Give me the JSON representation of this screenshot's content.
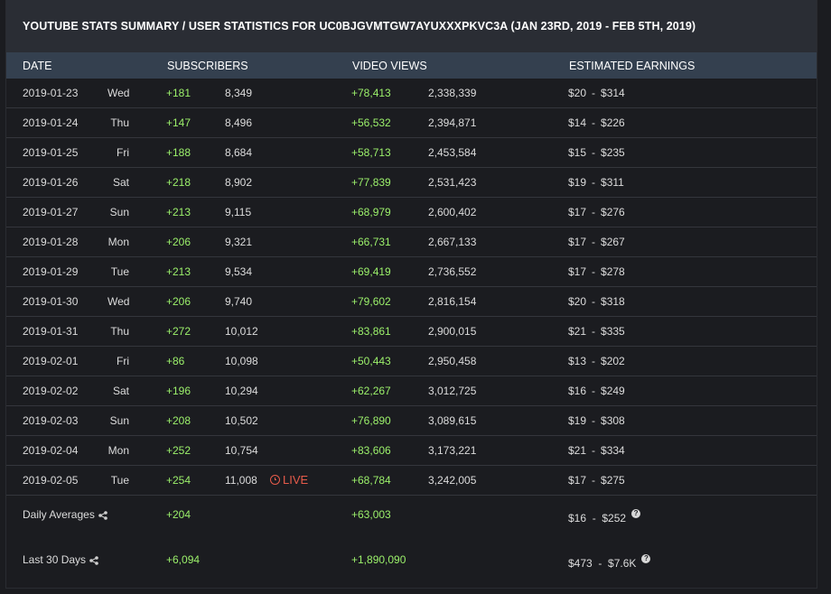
{
  "title": "YOUTUBE STATS SUMMARY / USER STATISTICS FOR UC0BJGVMTGW7AYUXXXPKVC3A (JAN 23RD, 2019 - FEB 5TH, 2019)",
  "headers": {
    "date": "DATE",
    "subscribers": "SUBSCRIBERS",
    "views": "VIDEO VIEWS",
    "earnings": "ESTIMATED EARNINGS"
  },
  "rows": [
    {
      "date": "2019-01-23",
      "day": "Wed",
      "sub_delta": "+181",
      "sub_total": "8,349",
      "view_delta": "+78,413",
      "view_total": "2,338,339",
      "earn_low": "$20",
      "earn_high": "$314",
      "live": ""
    },
    {
      "date": "2019-01-24",
      "day": "Thu",
      "sub_delta": "+147",
      "sub_total": "8,496",
      "view_delta": "+56,532",
      "view_total": "2,394,871",
      "earn_low": "$14",
      "earn_high": "$226",
      "live": ""
    },
    {
      "date": "2019-01-25",
      "day": "Fri",
      "sub_delta": "+188",
      "sub_total": "8,684",
      "view_delta": "+58,713",
      "view_total": "2,453,584",
      "earn_low": "$15",
      "earn_high": "$235",
      "live": ""
    },
    {
      "date": "2019-01-26",
      "day": "Sat",
      "sub_delta": "+218",
      "sub_total": "8,902",
      "view_delta": "+77,839",
      "view_total": "2,531,423",
      "earn_low": "$19",
      "earn_high": "$311",
      "live": ""
    },
    {
      "date": "2019-01-27",
      "day": "Sun",
      "sub_delta": "+213",
      "sub_total": "9,115",
      "view_delta": "+68,979",
      "view_total": "2,600,402",
      "earn_low": "$17",
      "earn_high": "$276",
      "live": ""
    },
    {
      "date": "2019-01-28",
      "day": "Mon",
      "sub_delta": "+206",
      "sub_total": "9,321",
      "view_delta": "+66,731",
      "view_total": "2,667,133",
      "earn_low": "$17",
      "earn_high": "$267",
      "live": ""
    },
    {
      "date": "2019-01-29",
      "day": "Tue",
      "sub_delta": "+213",
      "sub_total": "9,534",
      "view_delta": "+69,419",
      "view_total": "2,736,552",
      "earn_low": "$17",
      "earn_high": "$278",
      "live": ""
    },
    {
      "date": "2019-01-30",
      "day": "Wed",
      "sub_delta": "+206",
      "sub_total": "9,740",
      "view_delta": "+79,602",
      "view_total": "2,816,154",
      "earn_low": "$20",
      "earn_high": "$318",
      "live": ""
    },
    {
      "date": "2019-01-31",
      "day": "Thu",
      "sub_delta": "+272",
      "sub_total": "10,012",
      "view_delta": "+83,861",
      "view_total": "2,900,015",
      "earn_low": "$21",
      "earn_high": "$335",
      "live": ""
    },
    {
      "date": "2019-02-01",
      "day": "Fri",
      "sub_delta": "+86",
      "sub_total": "10,098",
      "view_delta": "+50,443",
      "view_total": "2,950,458",
      "earn_low": "$13",
      "earn_high": "$202",
      "live": ""
    },
    {
      "date": "2019-02-02",
      "day": "Sat",
      "sub_delta": "+196",
      "sub_total": "10,294",
      "view_delta": "+62,267",
      "view_total": "3,012,725",
      "earn_low": "$16",
      "earn_high": "$249",
      "live": ""
    },
    {
      "date": "2019-02-03",
      "day": "Sun",
      "sub_delta": "+208",
      "sub_total": "10,502",
      "view_delta": "+76,890",
      "view_total": "3,089,615",
      "earn_low": "$19",
      "earn_high": "$308",
      "live": ""
    },
    {
      "date": "2019-02-04",
      "day": "Mon",
      "sub_delta": "+252",
      "sub_total": "10,754",
      "view_delta": "+83,606",
      "view_total": "3,173,221",
      "earn_low": "$21",
      "earn_high": "$334",
      "live": ""
    },
    {
      "date": "2019-02-05",
      "day": "Tue",
      "sub_delta": "+254",
      "sub_total": "11,008",
      "view_delta": "+68,784",
      "view_total": "3,242,005",
      "earn_low": "$17",
      "earn_high": "$275",
      "live": "LIVE"
    }
  ],
  "earn_separator": "-",
  "summary": {
    "daily": {
      "label": "Daily Averages",
      "subs": "+204",
      "views": "+63,003",
      "earnings": "$16  -  $252"
    },
    "last30": {
      "label": "Last 30 Days",
      "subs": "+6,094",
      "views": "+1,890,090",
      "earnings": "$473  -  $7.6K"
    }
  },
  "icons": {
    "share": "share-icon",
    "help": "help-icon",
    "live": "clock-icon"
  },
  "colors": {
    "positive": "#9cf16b",
    "live": "#e65b4a",
    "header_bg": "#34404f",
    "title_bg": "#2a2d34",
    "page_bg": "#1b1c20"
  }
}
